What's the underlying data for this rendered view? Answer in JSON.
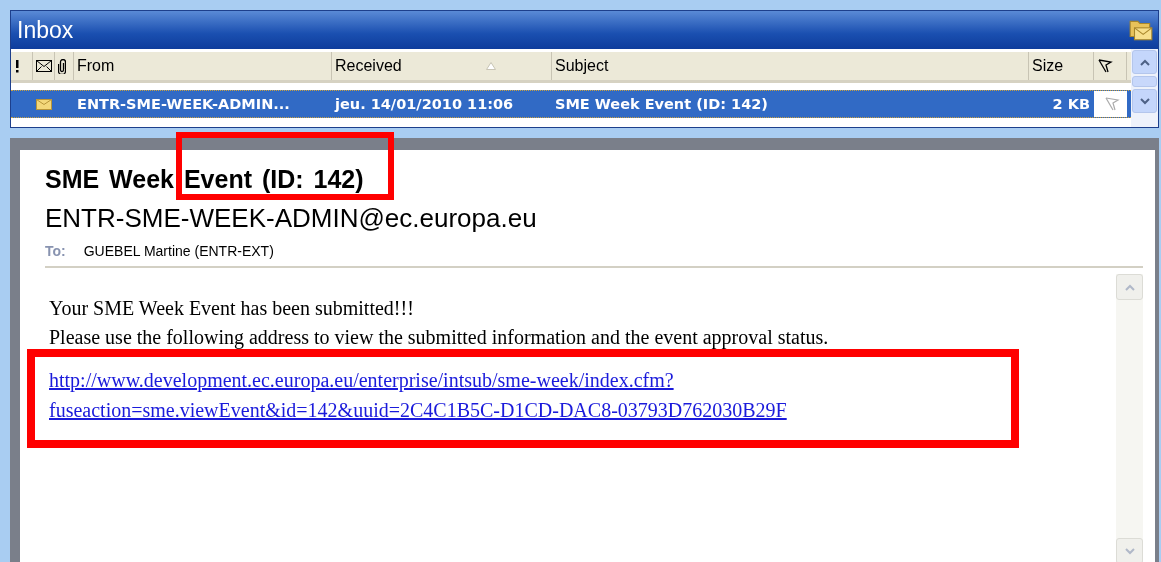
{
  "window": {
    "title": "Inbox"
  },
  "message_list": {
    "columns": [
      {
        "kind": "importance"
      },
      {
        "kind": "icon"
      },
      {
        "kind": "attachment"
      },
      {
        "kind": "text",
        "label": "From",
        "sorted": false
      },
      {
        "kind": "text",
        "label": "Received",
        "sorted": true
      },
      {
        "kind": "text",
        "label": "Subject",
        "sorted": false
      },
      {
        "kind": "text",
        "label": "Size",
        "sorted": false
      },
      {
        "kind": "flag"
      }
    ],
    "rows": [
      {
        "selected": true,
        "from": "ENTR-SME-WEEK-ADMIN...",
        "received": "jeu. 14/01/2010 11:06",
        "subject": "SME Week Event (ID: 142)",
        "size": "2 KB"
      }
    ]
  },
  "reading_pane": {
    "subject": "SME Week Event (ID: 142)",
    "sender": "ENTR-SME-WEEK-ADMIN@ec.europa.eu",
    "to_label": "To:",
    "to": "GUEBEL Martine (ENTR-EXT)",
    "body": [
      "Your SME Week Event has been submitted!!!",
      "Please use the following address to view the submitted information and the event approval status."
    ],
    "link": [
      "http://www.development.ec.europa.eu/enterprise/intsub/sme-week/index.cfm?",
      "fuseaction=sme.viewEvent&id=142&uuid=2C4C1B5C-D1CD-DAC8-03793D762030B29F"
    ]
  }
}
